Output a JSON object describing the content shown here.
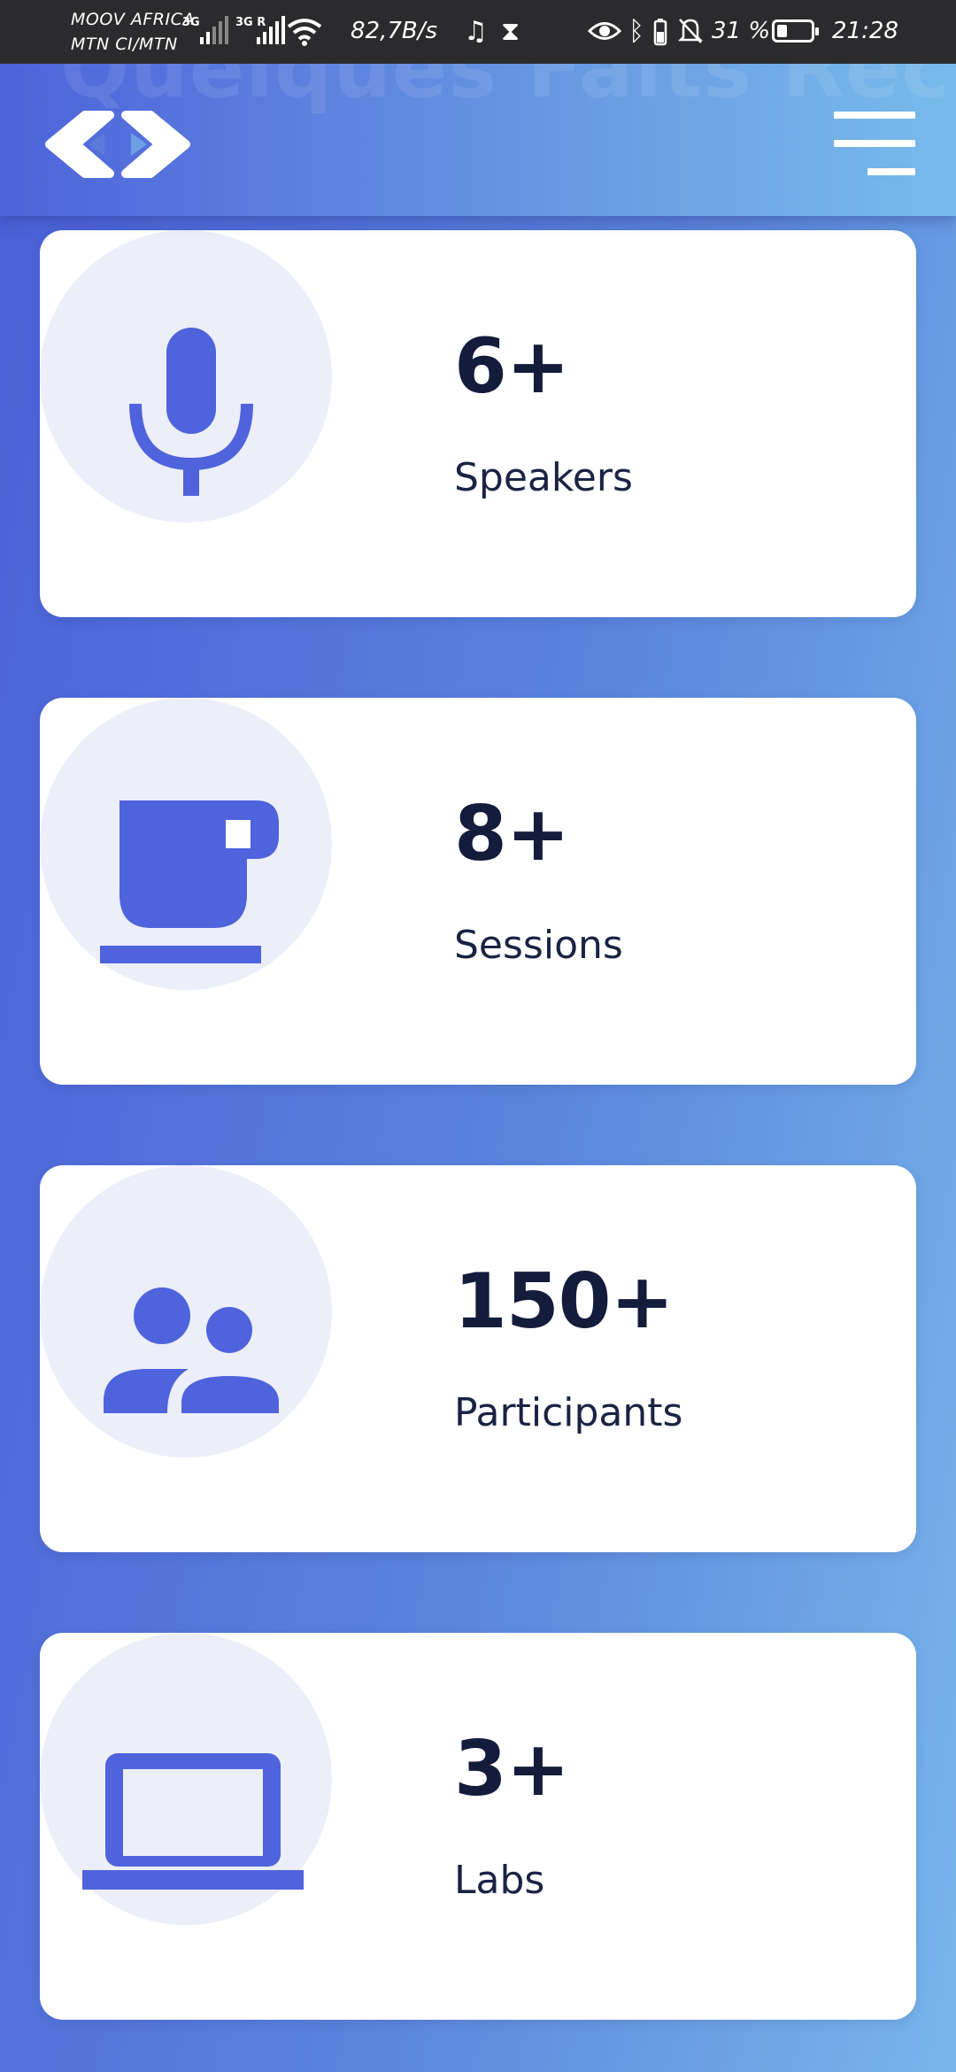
{
  "status_bar": {
    "carrier_1": "MOOV AFRICA",
    "carrier_2": "MTN CI/MTN",
    "net_1": "3G",
    "net_2": "3G R",
    "speed": "82,7B/s",
    "battery_text": "31 %",
    "battery_level": 0.31,
    "time": "21:28"
  },
  "header": {
    "background_heading": "Quelques Faits Rec",
    "logo_icon": "code-brackets-logo",
    "menu_icon": "hamburger-menu-icon"
  },
  "colors": {
    "accent": "#4f63dc",
    "text_dark": "#141c3c",
    "circle_bg": "#eceef9"
  },
  "stats": [
    {
      "icon": "microphone-icon",
      "value": "6+",
      "label": "Speakers"
    },
    {
      "icon": "coffee-cup-icon",
      "value": "8+",
      "label": "Sessions"
    },
    {
      "icon": "people-icon",
      "value": "150+",
      "label": "Participants"
    },
    {
      "icon": "laptop-icon",
      "value": "3+",
      "label": "Labs"
    }
  ]
}
